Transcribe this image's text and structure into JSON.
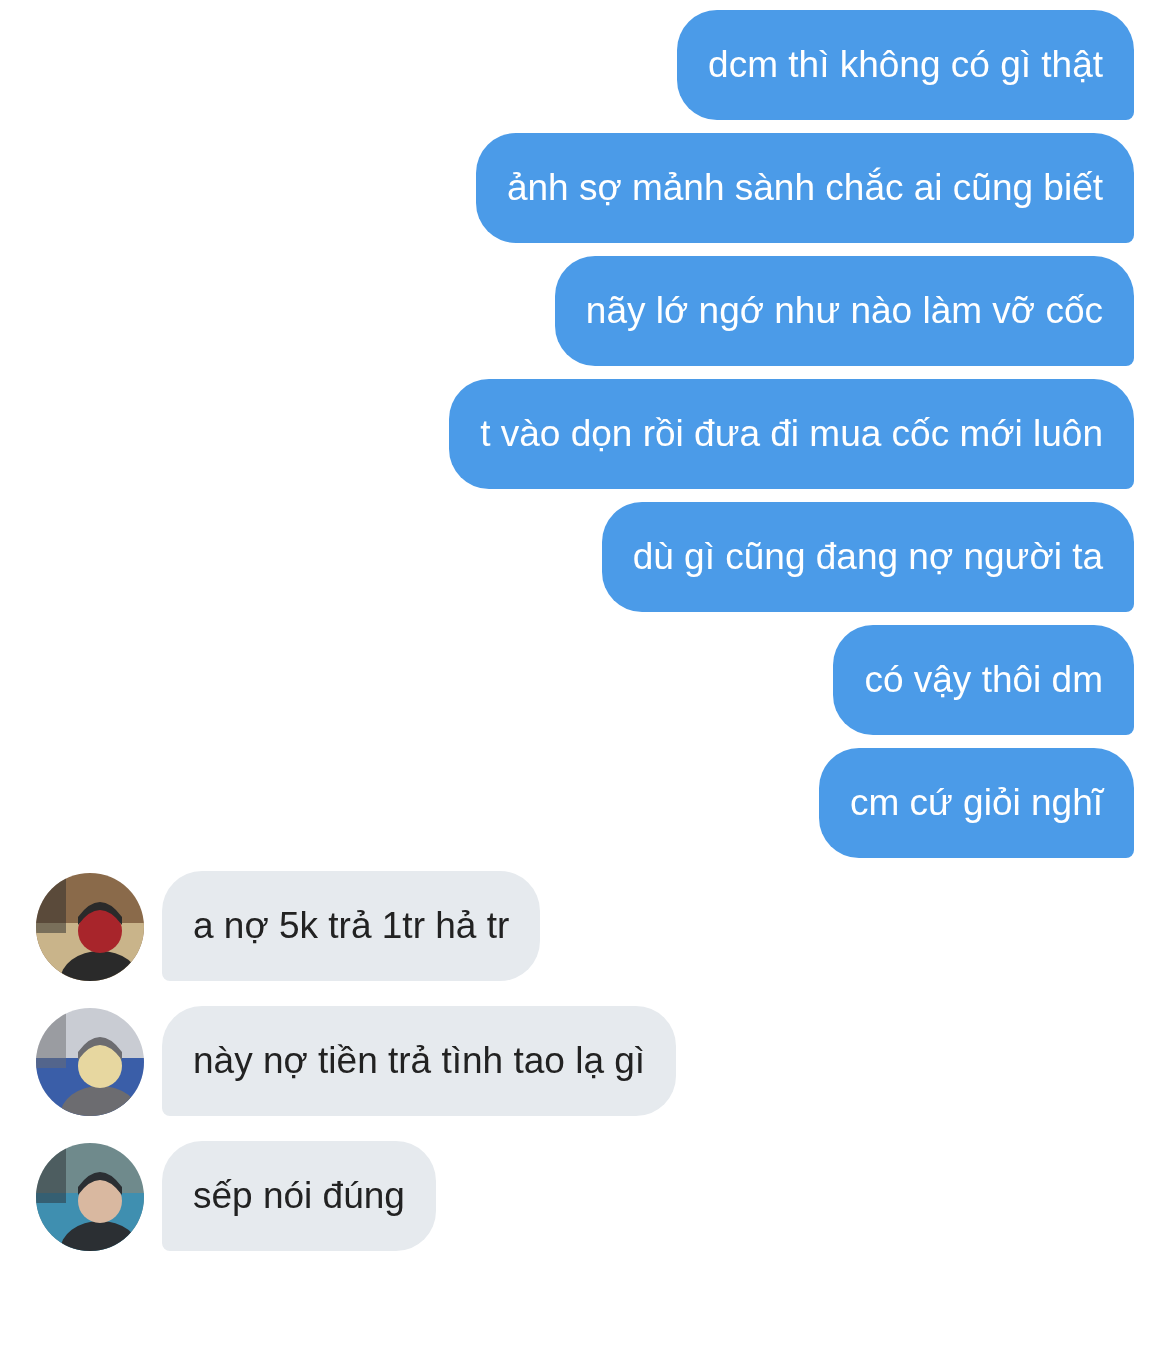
{
  "messages": [
    {
      "kind": "sent",
      "text": "dcm thì không có gì thật"
    },
    {
      "kind": "sent",
      "text": "ảnh sợ mảnh sành chắc ai cũng biết"
    },
    {
      "kind": "sent",
      "text": "nãy lớ ngớ như nào làm vỡ cốc"
    },
    {
      "kind": "sent",
      "text": "t vào dọn rồi đưa đi mua cốc mới luôn"
    },
    {
      "kind": "sent",
      "text": "dù gì cũng đang nợ người ta"
    },
    {
      "kind": "sent",
      "text": "có vậy thôi dm"
    },
    {
      "kind": "sent",
      "text": "cm cứ giỏi nghĩ"
    },
    {
      "kind": "received",
      "text": "a nợ 5k trả 1tr hả tr"
    },
    {
      "kind": "received",
      "text": "này nợ tiền trả tình tao lạ gì"
    },
    {
      "kind": "received",
      "text": "sếp nói đúng"
    }
  ]
}
